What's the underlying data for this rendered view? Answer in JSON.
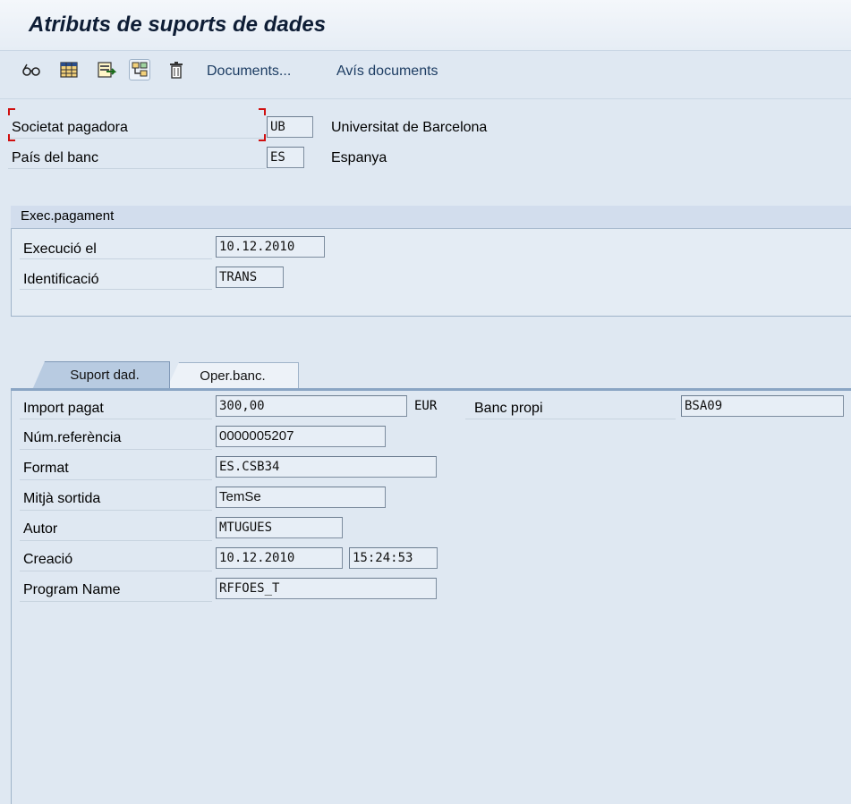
{
  "title": "Atributs de suports de dades",
  "toolbar": {
    "icons": [
      "glasses-icon",
      "table-icon",
      "export-icon",
      "hierarchy-icon",
      "trash-icon"
    ],
    "links": [
      "Documents...",
      "Avís documents"
    ]
  },
  "header_fields": {
    "company": {
      "label": "Societat pagadora",
      "value": "UB",
      "text": "Universitat de Barcelona"
    },
    "country": {
      "label": "País del banc",
      "value": "ES",
      "text": "Espanya"
    }
  },
  "payment_run": {
    "group_title": "Exec.pagament",
    "run_date": {
      "label": "Execució el",
      "value": "10.12.2010"
    },
    "identification": {
      "label": "Identificació",
      "value": "TRANS"
    }
  },
  "tabs": [
    {
      "label": "Suport dad.",
      "active": true
    },
    {
      "label": "Oper.banc.",
      "active": false
    }
  ],
  "details": {
    "amount_paid": {
      "label": "Import pagat",
      "value": "300,00",
      "currency": "EUR"
    },
    "house_bank": {
      "label": "Banc propi",
      "value": "BSA09"
    },
    "reference": {
      "label": "Núm.referència",
      "value": "0000005207"
    },
    "format": {
      "label": "Format",
      "value": "ES.CSB34"
    },
    "output_medium": {
      "label": "Mitjà sortida",
      "value": "TemSe"
    },
    "author": {
      "label": "Autor",
      "value": "MTUGUES"
    },
    "created": {
      "label": "Creació",
      "date": "10.12.2010",
      "time": "15:24:53"
    },
    "program": {
      "label": "Program Name",
      "value": "RFFOES_T"
    }
  },
  "colors": {
    "background": "#dfe8f2",
    "title": "#0e1d35",
    "link": "#1d3d63",
    "focus": "#d01010"
  }
}
